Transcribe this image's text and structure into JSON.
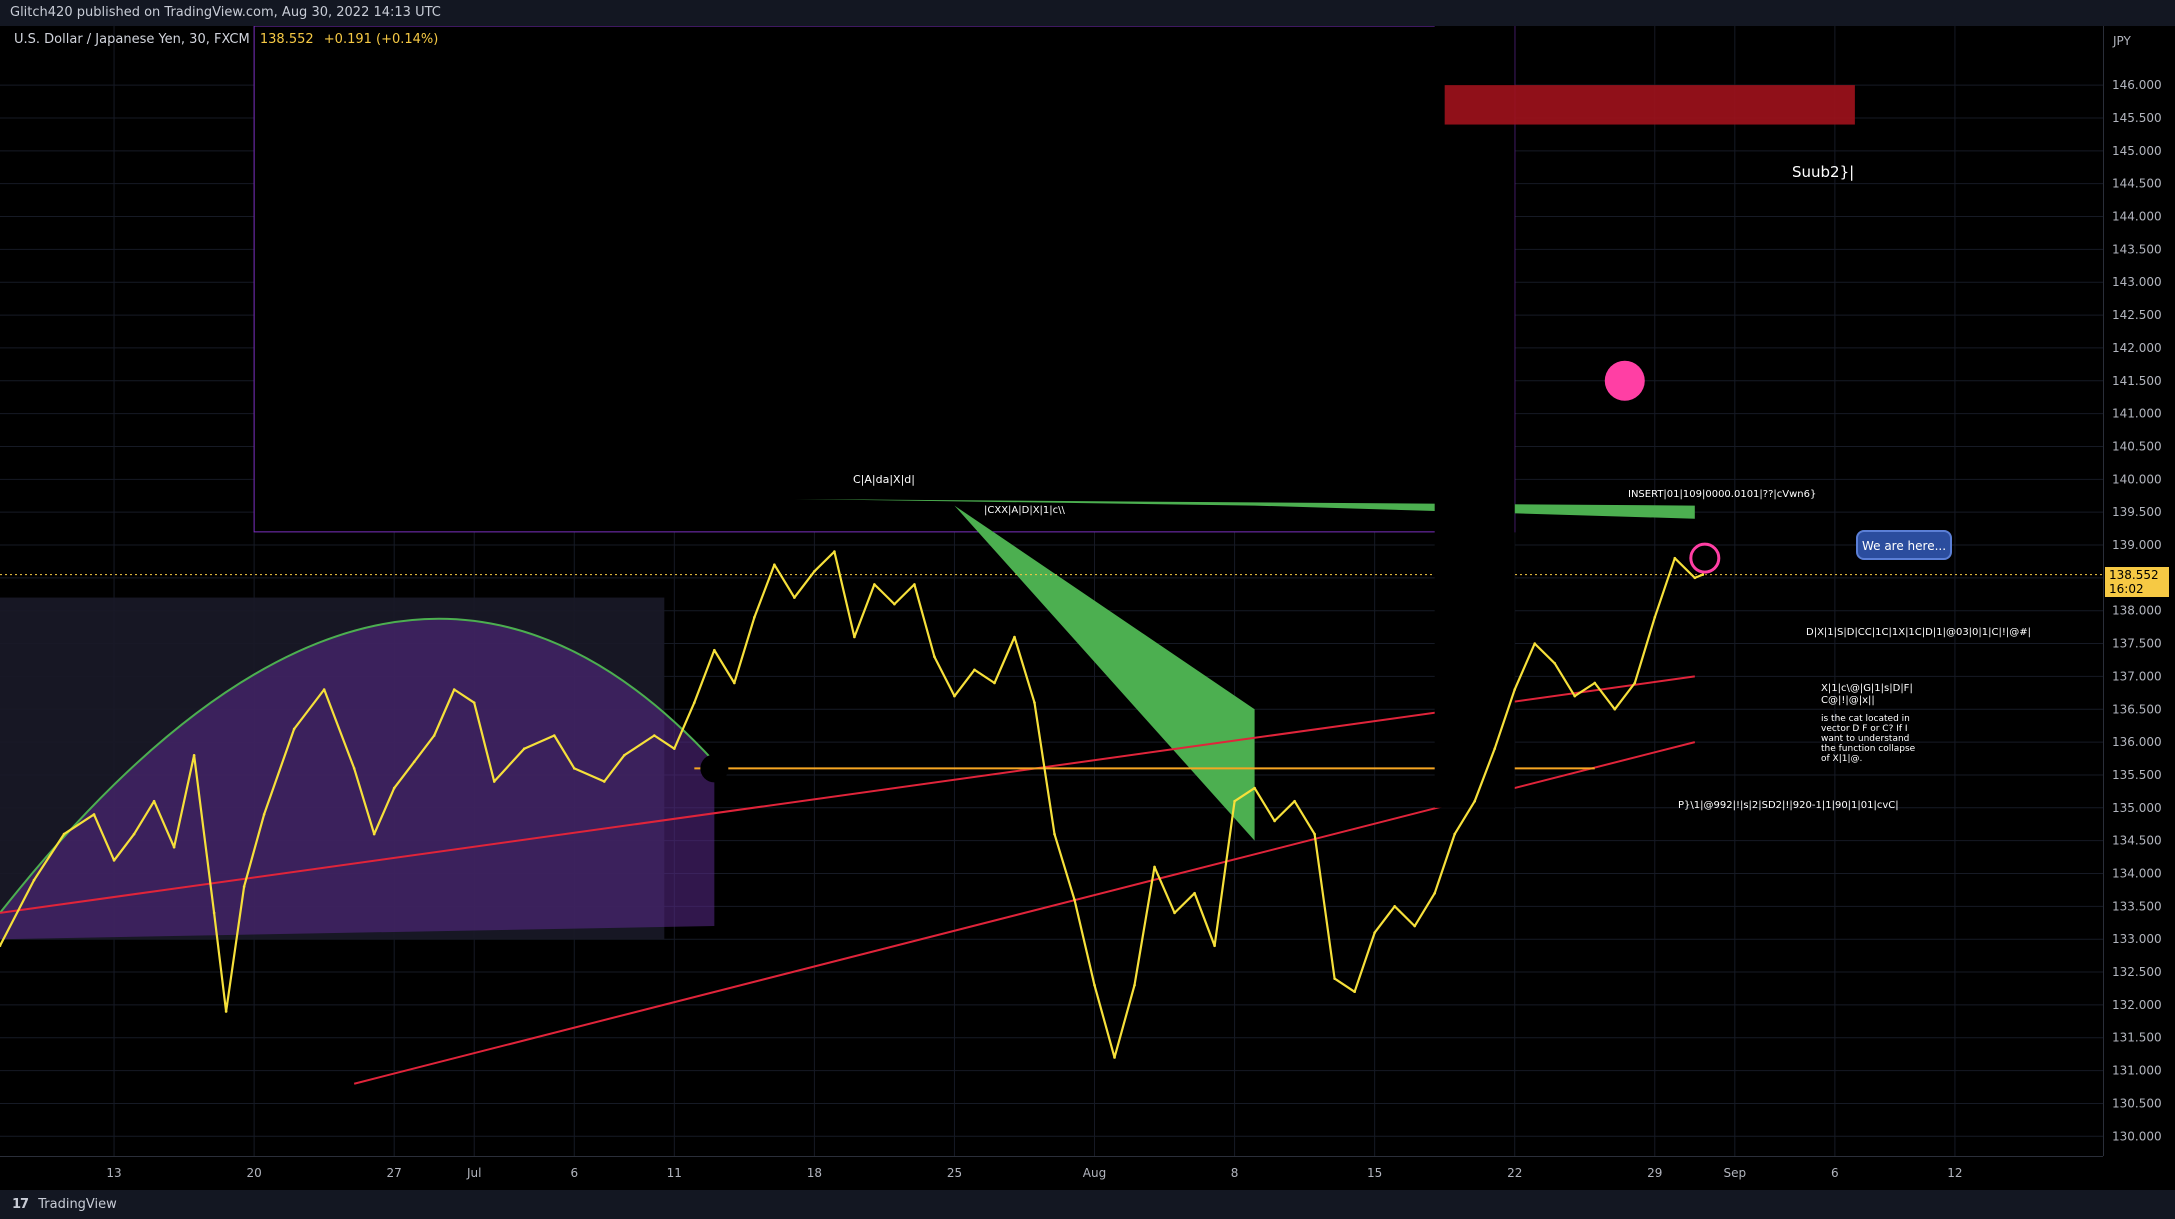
{
  "header": {
    "published": "Glitch420 published on TradingView.com, Aug 30, 2022 14:13 UTC"
  },
  "legend": {
    "symbol": "U.S. Dollar / Japanese Yen, 30, FXCM",
    "price": "138.552",
    "change": "+0.191 (+0.14%)"
  },
  "price_tag": {
    "price": "138.552",
    "countdown": "16:02"
  },
  "annotations": {
    "callout": "We are here...",
    "suub": "Suub2}|",
    "top_label": "C|A|da|X|d|",
    "insert": "INSERT|01|109|0000.0101|??|cVwn6}",
    "cxx": "|CXX|A|D|X|1|c\\\\",
    "right1": "D|X|1|S|D|CC|1C|1X|1C|D|1|@03|0|1|C|!|@#|",
    "right2": "X|1|c\\@|G|1|s|D|F|\nC@|!|@|x||",
    "question": "is the cat located in\nvector D F or C? If I\nwant to understand\nthe function collapse\nof X|1|@.",
    "bottom_right": "P}\\1|@992|!|s|2|SD2|!|920-1|1|90|1|01|cvC|"
  },
  "colors": {
    "background": "#000000",
    "price_line": "#f6e03a",
    "accent": "#f6c944",
    "purple_fill": "#5a2a8a",
    "green_wedge": "#4caf50",
    "red_line": "#e0243a"
  },
  "chart_data": {
    "type": "line",
    "title": "",
    "ylabel": "JPY",
    "y_unit": "JPY",
    "ylim": [
      129.7,
      146.9
    ],
    "y_ticks": [
      "146.000",
      "145.500",
      "145.000",
      "144.500",
      "144.000",
      "143.500",
      "143.000",
      "142.500",
      "142.000",
      "141.500",
      "141.000",
      "140.500",
      "140.000",
      "139.500",
      "139.000",
      "138.500",
      "138.000",
      "137.500",
      "137.000",
      "136.500",
      "136.000",
      "135.500",
      "135.000",
      "134.500",
      "134.000",
      "133.500",
      "133.000",
      "132.500",
      "132.000",
      "131.500",
      "131.000",
      "130.500",
      "130.000"
    ],
    "x_ticks": [
      {
        "label": "13",
        "idx": 13
      },
      {
        "label": "20",
        "idx": 20
      },
      {
        "label": "27",
        "idx": 27
      },
      {
        "label": "Jul",
        "idx": 31
      },
      {
        "label": "6",
        "idx": 36
      },
      {
        "label": "11",
        "idx": 41
      },
      {
        "label": "18",
        "idx": 48
      },
      {
        "label": "25",
        "idx": 55
      },
      {
        "label": "Aug",
        "idx": 62
      },
      {
        "label": "8",
        "idx": 69
      },
      {
        "label": "15",
        "idx": 76
      },
      {
        "label": "22",
        "idx": 83
      },
      {
        "label": "29",
        "idx": 90
      },
      {
        "label": "Sep",
        "idx": 94
      },
      {
        "label": "6",
        "idx": 99
      },
      {
        "label": "12",
        "idx": 105
      }
    ],
    "xlim": [
      7.3,
      112.4
    ],
    "series": [
      {
        "values": [
          {
            "x": 7.3,
            "y": 132.9
          },
          {
            "x": 9,
            "y": 133.9
          },
          {
            "x": 10.5,
            "y": 134.6
          },
          {
            "x": 12,
            "y": 134.9
          },
          {
            "x": 13,
            "y": 134.2
          },
          {
            "x": 14,
            "y": 134.6
          },
          {
            "x": 15,
            "y": 135.1
          },
          {
            "x": 16,
            "y": 134.4
          },
          {
            "x": 17,
            "y": 135.8
          },
          {
            "x": 18,
            "y": 133.4
          },
          {
            "x": 18.6,
            "y": 131.9
          },
          {
            "x": 19.5,
            "y": 133.8
          },
          {
            "x": 20.5,
            "y": 134.9
          },
          {
            "x": 22,
            "y": 136.2
          },
          {
            "x": 23.5,
            "y": 136.8
          },
          {
            "x": 25,
            "y": 135.6
          },
          {
            "x": 26,
            "y": 134.6
          },
          {
            "x": 27,
            "y": 135.3
          },
          {
            "x": 28,
            "y": 135.7
          },
          {
            "x": 29,
            "y": 136.1
          },
          {
            "x": 30,
            "y": 136.8
          },
          {
            "x": 31,
            "y": 136.6
          },
          {
            "x": 32,
            "y": 135.4
          },
          {
            "x": 33.5,
            "y": 135.9
          },
          {
            "x": 35,
            "y": 136.1
          },
          {
            "x": 36,
            "y": 135.6
          },
          {
            "x": 37.5,
            "y": 135.4
          },
          {
            "x": 38.5,
            "y": 135.8
          },
          {
            "x": 40,
            "y": 136.1
          },
          {
            "x": 41,
            "y": 135.9
          },
          {
            "x": 42,
            "y": 136.6
          },
          {
            "x": 43,
            "y": 137.4
          },
          {
            "x": 44,
            "y": 136.9
          },
          {
            "x": 45,
            "y": 137.9
          },
          {
            "x": 46,
            "y": 138.7
          },
          {
            "x": 47,
            "y": 138.2
          },
          {
            "x": 48,
            "y": 138.6
          },
          {
            "x": 49,
            "y": 138.9
          },
          {
            "x": 50,
            "y": 137.6
          },
          {
            "x": 51,
            "y": 138.4
          },
          {
            "x": 52,
            "y": 138.1
          },
          {
            "x": 53,
            "y": 138.4
          },
          {
            "x": 54,
            "y": 137.3
          },
          {
            "x": 55,
            "y": 136.7
          },
          {
            "x": 56,
            "y": 137.1
          },
          {
            "x": 57,
            "y": 136.9
          },
          {
            "x": 58,
            "y": 137.6
          },
          {
            "x": 59,
            "y": 136.6
          },
          {
            "x": 60,
            "y": 134.6
          },
          {
            "x": 61,
            "y": 133.6
          },
          {
            "x": 62,
            "y": 132.3
          },
          {
            "x": 63,
            "y": 131.2
          },
          {
            "x": 64,
            "y": 132.3
          },
          {
            "x": 65,
            "y": 134.1
          },
          {
            "x": 66,
            "y": 133.4
          },
          {
            "x": 67,
            "y": 133.7
          },
          {
            "x": 68,
            "y": 132.9
          },
          {
            "x": 69,
            "y": 135.1
          },
          {
            "x": 70,
            "y": 135.3
          },
          {
            "x": 71,
            "y": 134.8
          },
          {
            "x": 72,
            "y": 135.1
          },
          {
            "x": 73,
            "y": 134.6
          },
          {
            "x": 74,
            "y": 132.4
          },
          {
            "x": 75,
            "y": 132.2
          },
          {
            "x": 76,
            "y": 133.1
          },
          {
            "x": 77,
            "y": 133.5
          },
          {
            "x": 78,
            "y": 133.2
          },
          {
            "x": 79,
            "y": 133.7
          },
          {
            "x": 80,
            "y": 134.6
          },
          {
            "x": 81,
            "y": 135.1
          },
          {
            "x": 82,
            "y": 135.9
          },
          {
            "x": 83,
            "y": 136.8
          },
          {
            "x": 84,
            "y": 137.5
          },
          {
            "x": 85,
            "y": 137.2
          },
          {
            "x": 86,
            "y": 136.7
          },
          {
            "x": 87,
            "y": 136.9
          },
          {
            "x": 88,
            "y": 136.5
          },
          {
            "x": 89,
            "y": 136.9
          },
          {
            "x": 90,
            "y": 137.9
          },
          {
            "x": 91,
            "y": 138.8
          },
          {
            "x": 92,
            "y": 138.5
          },
          {
            "x": 92.4,
            "y": 138.55
          }
        ]
      }
    ],
    "grid": true,
    "legend": "none"
  }
}
